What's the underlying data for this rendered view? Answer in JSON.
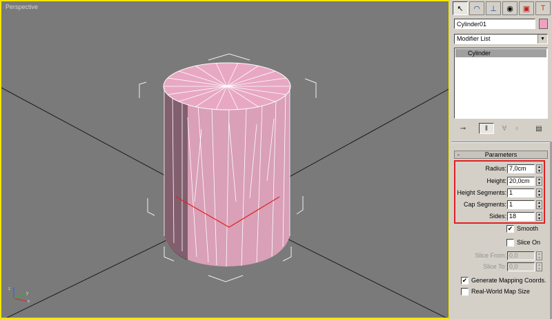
{
  "viewport": {
    "label": "Perspective",
    "axes": {
      "x": "x",
      "y": "y",
      "z": "z"
    },
    "colors": {
      "border": "#f2e600",
      "background": "#7a7a7a",
      "object": "#e0a0c0"
    }
  },
  "toolbar": {
    "tabs": [
      {
        "icon": "arrow-cursor-icon"
      },
      {
        "icon": "curve-modify-icon"
      },
      {
        "icon": "hierarchy-icon"
      },
      {
        "icon": "motion-icon"
      },
      {
        "icon": "display-icon"
      },
      {
        "icon": "utilities-hammer-icon"
      }
    ]
  },
  "object": {
    "name": "Cylinder01",
    "color": "#f0a0c0"
  },
  "modifier_list": {
    "label": "Modifier List",
    "stack_items": [
      "Cylinder"
    ]
  },
  "parameters": {
    "title": "Parameters",
    "collapse_symbol": "-",
    "radius": {
      "label": "Radius:",
      "value": "7,0cm"
    },
    "height": {
      "label": "Height:",
      "value": "20,0cm"
    },
    "height_segments": {
      "label": "Height Segments:",
      "value": "1"
    },
    "cap_segments": {
      "label": "Cap Segments:",
      "value": "1"
    },
    "sides": {
      "label": "Sides:",
      "value": "18"
    },
    "smooth": {
      "label": "Smooth",
      "checked": true,
      "mark": "✔"
    },
    "slice_on": {
      "label": "Slice On",
      "checked": false
    },
    "slice_from": {
      "label": "Slice From:",
      "value": "0,0"
    },
    "slice_to": {
      "label": "Slice To:",
      "value": "0,0"
    },
    "generate_mapping": {
      "label": "Generate Mapping Coords.",
      "checked": true,
      "mark": "✔"
    },
    "real_world": {
      "label": "Real-World Map Size",
      "checked": false
    }
  }
}
